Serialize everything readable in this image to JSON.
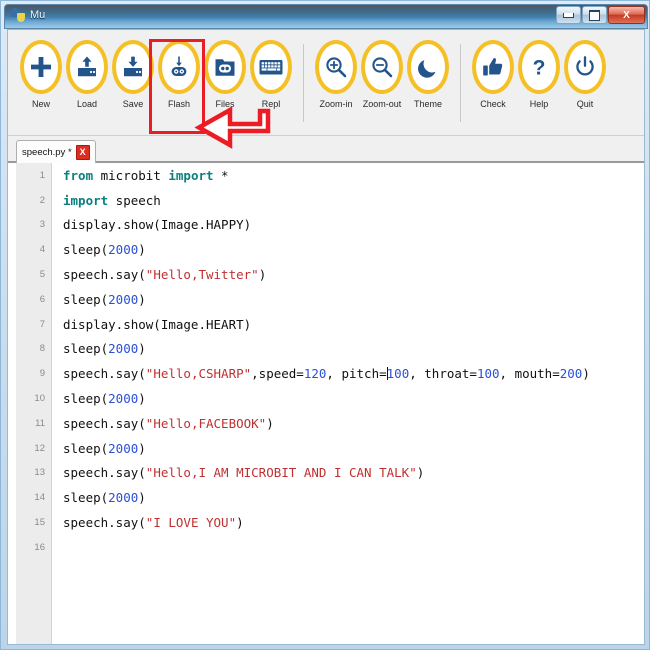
{
  "window": {
    "title": "Mu",
    "app_icon": "python-logo-icon",
    "controls": {
      "minimize": "minimize-icon",
      "maximize": "maximize-icon",
      "close": "X"
    }
  },
  "toolbar": {
    "items": [
      {
        "label": "New",
        "icon": "plus-icon"
      },
      {
        "label": "Load",
        "icon": "upload-folder-icon"
      },
      {
        "label": "Save",
        "icon": "download-folder-icon"
      },
      {
        "label": "Flash",
        "icon": "robot-flash-icon"
      },
      {
        "label": "Files",
        "icon": "folder-robot-icon"
      },
      {
        "label": "Repl",
        "icon": "keyboard-icon"
      },
      {
        "label": "Zoom-in",
        "icon": "magnifier-plus-icon"
      },
      {
        "label": "Zoom-out",
        "icon": "magnifier-minus-icon"
      },
      {
        "label": "Theme",
        "icon": "moon-icon"
      },
      {
        "label": "Check",
        "icon": "thumbs-up-icon"
      },
      {
        "label": "Help",
        "icon": "question-mark-icon"
      },
      {
        "label": "Quit",
        "icon": "power-icon"
      }
    ],
    "highlighted_item": "Flash",
    "annotation": "red-arrow-pointing-to-flash"
  },
  "tabs": [
    {
      "title": "speech.py *",
      "close_label": "X",
      "active": true
    }
  ],
  "editor": {
    "lines": [
      {
        "n": "1",
        "tokens": [
          {
            "t": "from",
            "c": "kw"
          },
          {
            "t": " microbit ",
            "c": "op"
          },
          {
            "t": "import",
            "c": "kw"
          },
          {
            "t": " *",
            "c": "op"
          }
        ]
      },
      {
        "n": "2",
        "tokens": [
          {
            "t": "import",
            "c": "kw"
          },
          {
            "t": " speech",
            "c": "op"
          }
        ]
      },
      {
        "n": "3",
        "tokens": [
          {
            "t": "display.show(Image.HAPPY)",
            "c": "op"
          }
        ]
      },
      {
        "n": "4",
        "tokens": [
          {
            "t": "sleep(",
            "c": "op"
          },
          {
            "t": "2000",
            "c": "num"
          },
          {
            "t": ")",
            "c": "op"
          }
        ]
      },
      {
        "n": "5",
        "tokens": [
          {
            "t": "speech.say(",
            "c": "op"
          },
          {
            "t": "\"Hello,Twitter\"",
            "c": "str"
          },
          {
            "t": ")",
            "c": "op"
          }
        ]
      },
      {
        "n": "6",
        "tokens": [
          {
            "t": "sleep(",
            "c": "op"
          },
          {
            "t": "2000",
            "c": "num"
          },
          {
            "t": ")",
            "c": "op"
          }
        ]
      },
      {
        "n": "7",
        "tokens": [
          {
            "t": "display.show(Image.HEART)",
            "c": "op"
          }
        ]
      },
      {
        "n": "8",
        "tokens": [
          {
            "t": "sleep(",
            "c": "op"
          },
          {
            "t": "2000",
            "c": "num"
          },
          {
            "t": ")",
            "c": "op"
          }
        ]
      },
      {
        "n": "9",
        "tokens": [
          {
            "t": "speech.say(",
            "c": "op"
          },
          {
            "t": "\"Hello,CSHARP\"",
            "c": "str"
          },
          {
            "t": ",speed=",
            "c": "op"
          },
          {
            "t": "120",
            "c": "num"
          },
          {
            "t": ", pitch=",
            "c": "op"
          },
          {
            "t": "",
            "c": "caret"
          },
          {
            "t": "100",
            "c": "num"
          },
          {
            "t": ", throat=",
            "c": "op"
          },
          {
            "t": "100",
            "c": "num"
          },
          {
            "t": ", mouth=",
            "c": "op"
          },
          {
            "t": "200",
            "c": "num"
          },
          {
            "t": ")",
            "c": "op"
          }
        ]
      },
      {
        "n": "10",
        "tokens": [
          {
            "t": "sleep(",
            "c": "op"
          },
          {
            "t": "2000",
            "c": "num"
          },
          {
            "t": ")",
            "c": "op"
          }
        ]
      },
      {
        "n": "11",
        "tokens": [
          {
            "t": "speech.say(",
            "c": "op"
          },
          {
            "t": "\"Hello,FACEBOOK\"",
            "c": "str"
          },
          {
            "t": ")",
            "c": "op"
          }
        ]
      },
      {
        "n": "12",
        "tokens": [
          {
            "t": "sleep(",
            "c": "op"
          },
          {
            "t": "2000",
            "c": "num"
          },
          {
            "t": ")",
            "c": "op"
          }
        ]
      },
      {
        "n": "13",
        "tokens": [
          {
            "t": "speech.say(",
            "c": "op"
          },
          {
            "t": "\"Hello,I AM MICROBIT AND I CAN TALK\"",
            "c": "str"
          },
          {
            "t": ")",
            "c": "op"
          }
        ]
      },
      {
        "n": "14",
        "tokens": [
          {
            "t": "sleep(",
            "c": "op"
          },
          {
            "t": "2000",
            "c": "num"
          },
          {
            "t": ")",
            "c": "op"
          }
        ]
      },
      {
        "n": "15",
        "tokens": [
          {
            "t": "speech.say(",
            "c": "op"
          },
          {
            "t": "\"I LOVE YOU\"",
            "c": "str"
          },
          {
            "t": ")",
            "c": "op"
          }
        ]
      },
      {
        "n": "16",
        "tokens": []
      }
    ]
  },
  "colors": {
    "accent_yellow": "#f5c026",
    "icon_blue": "#23558c",
    "annotation_red": "#ec1c24",
    "keyword": "#0a7f7f",
    "string": "#c03030",
    "number": "#2b4fd8"
  }
}
